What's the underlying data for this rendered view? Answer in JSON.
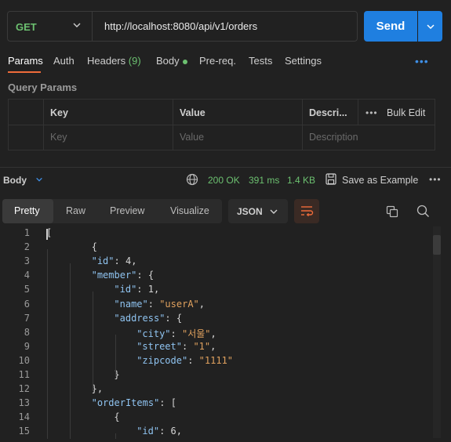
{
  "request": {
    "method": "GET",
    "url": "http://localhost:8080/api/v1/orders",
    "send_label": "Send"
  },
  "tabs": [
    {
      "label": "Params",
      "active": true
    },
    {
      "label": "Auth"
    },
    {
      "label": "Headers",
      "count": "(9)"
    },
    {
      "label": "Body",
      "indicator": "green-dot"
    },
    {
      "label": "Pre-req."
    },
    {
      "label": "Tests"
    },
    {
      "label": "Settings"
    }
  ],
  "more_icon": "ellipsis-icon",
  "query_params": {
    "title": "Query Params",
    "headers": {
      "key": "Key",
      "value": "Value",
      "description": "Descri...",
      "bulk_edit": "Bulk Edit"
    },
    "placeholders": {
      "key": "Key",
      "value": "Value",
      "description": "Description"
    }
  },
  "response": {
    "body_label": "Body",
    "status": "200 OK",
    "time": "391 ms",
    "size": "1.4 KB",
    "save_label": "Save as Example",
    "views": [
      "Pretty",
      "Raw",
      "Preview",
      "Visualize"
    ],
    "active_view": "Pretty",
    "format": "JSON",
    "status_color": "#6cc070",
    "accent_color": "#1f7fe0"
  },
  "code_lines": [
    {
      "n": "1",
      "text": "["
    },
    {
      "n": "2",
      "text": "    {"
    },
    {
      "n": "3",
      "key": "\"id\"",
      "val": " 4",
      "tail": ","
    },
    {
      "n": "4",
      "key": "\"member\"",
      "tail": " {"
    },
    {
      "n": "5",
      "key": "\"id\"",
      "val": " 1",
      "tail": ","
    },
    {
      "n": "6",
      "key": "\"name\"",
      "str": " \"userA\"",
      "tail": ","
    },
    {
      "n": "7",
      "key": "\"address\"",
      "tail": " {"
    },
    {
      "n": "8",
      "key": "\"city\"",
      "str": " \"서울\"",
      "tail": ","
    },
    {
      "n": "9",
      "key": "\"street\"",
      "str": " \"1\"",
      "tail": ","
    },
    {
      "n": "10",
      "key": "\"zipcode\"",
      "str": " \"1111\""
    },
    {
      "n": "11",
      "text": "}"
    },
    {
      "n": "12",
      "text": "},"
    },
    {
      "n": "13",
      "key": "\"orderItems\"",
      "tail": " ["
    },
    {
      "n": "14",
      "text": "{"
    },
    {
      "n": "15",
      "key": "\"id\"",
      "val": " 6",
      "tail": ","
    }
  ]
}
